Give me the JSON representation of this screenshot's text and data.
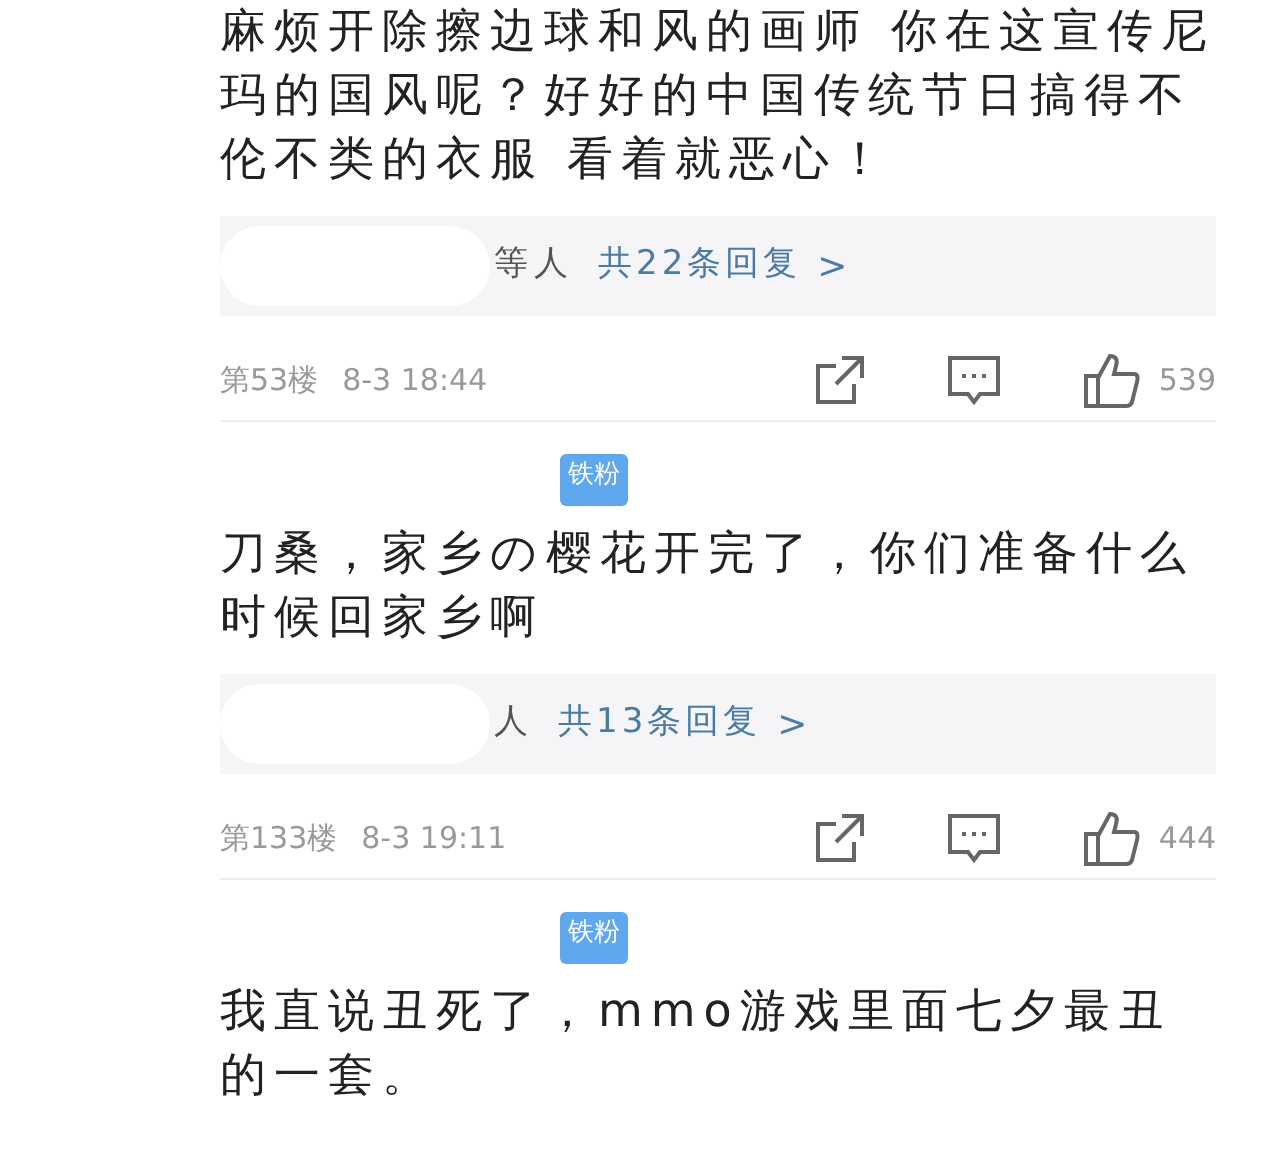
{
  "comments": [
    {
      "text": "麻烦开除擦边球和风的画师 你在这宣传尼玛的国风呢？好好的中国传统节日搞得不伦不类的衣服 看着就恶心！",
      "replies": {
        "names_suffix": "等人",
        "link": "共22条回复",
        "chevron": ">"
      },
      "floor": "第53楼",
      "time": "8-3 18:44",
      "likes": "539"
    },
    {
      "badge": "铁粉",
      "text": "刀桑，家乡の樱花开完了，你们准备什么时候回家乡啊",
      "replies": {
        "names_suffix": "人",
        "link": "共13条回复",
        "chevron": ">"
      },
      "floor": "第133楼",
      "time": "8-3 19:11",
      "likes": "444"
    },
    {
      "badge": "铁粉",
      "text": "我直说丑死了，mmo游戏里面七夕最丑的一套。"
    }
  ]
}
